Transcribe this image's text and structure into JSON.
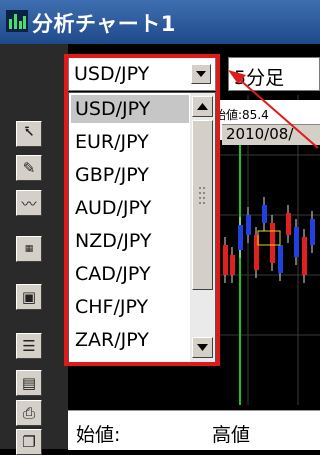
{
  "window": {
    "title": "分析チャート1"
  },
  "pair_select": {
    "value": "USD/JPY"
  },
  "interval_select": {
    "value": "5分足"
  },
  "chart_info": {
    "open_text": "始値:85.4",
    "date_text": "2010/08/"
  },
  "dropdown": {
    "items": [
      "USD/JPY",
      "EUR/JPY",
      "GBP/JPY",
      "AUD/JPY",
      "NZD/JPY",
      "CAD/JPY",
      "CHF/JPY",
      "ZAR/JPY"
    ],
    "selected": "USD/JPY"
  },
  "status": {
    "open_label": "始値:",
    "high_label": "高値"
  },
  "toolbar": {
    "icons": [
      "cursor-icon",
      "pencil-icon",
      "indicator-icon",
      "calendar-icon",
      "window-icon",
      "list-icon",
      "settings-icon",
      "print-icon",
      "copy-icon"
    ]
  },
  "colors": {
    "highlight": "#e01a1a",
    "title_bar": "#2d5a9c",
    "up_candle": "#e02020",
    "down_candle": "#2040e0",
    "marker": "#e8d020"
  }
}
